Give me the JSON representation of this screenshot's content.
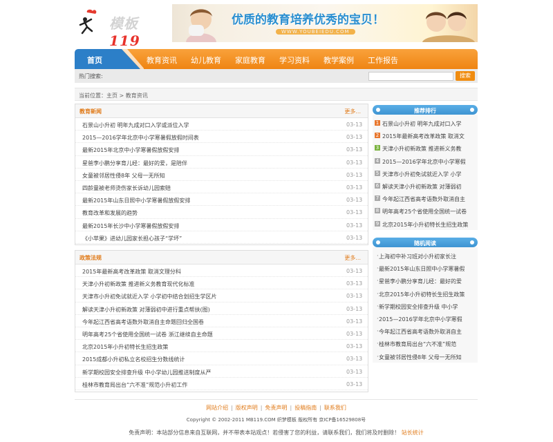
{
  "logo": {
    "text_a": "模板",
    "text_b": "119"
  },
  "banner": {
    "slogan": "优质的教育培养优秀的宝贝！",
    "url": "WWW.YOUBEIEDU.COM"
  },
  "nav": {
    "items": [
      "首页",
      "教育资讯",
      "幼儿教育",
      "家庭教育",
      "学习资料",
      "教学案例",
      "工作报告"
    ]
  },
  "search": {
    "hot_label": "热门搜索:",
    "button": "搜索",
    "placeholder": ""
  },
  "breadcrumb": "当前位置：主页 > 教育资讯",
  "education_news": {
    "title": "教育新闻",
    "more": "更多...",
    "items": [
      {
        "title": "石景山小升初 明年九成对口入学或派位入学",
        "date": "03-13"
      },
      {
        "title": "2015—2016学年北京中小学寒暑假放假时间表",
        "date": "03-13"
      },
      {
        "title": "最新2015年北京中小学寒暑假放假安排",
        "date": "03-13"
      },
      {
        "title": "星爸李小鹏分享育儿经：最好的爱，是陪伴",
        "date": "03-13"
      },
      {
        "title": "女童被邻居性侵8年 父母一无所知",
        "date": "03-13"
      },
      {
        "title": "四龄童被老师烫伤家长诉幼儿园索赔",
        "date": "03-13"
      },
      {
        "title": "最新2015年山东日照中小学寒暑假放假安排",
        "date": "03-13"
      },
      {
        "title": "教育改革和发展的趋势",
        "date": "03-13"
      },
      {
        "title": "最新2015年长沙中小学寒暑假放假安排",
        "date": "03-13"
      },
      {
        "title": "《小苹果》进幼儿园家长担心孩子“学坏”",
        "date": "03-13"
      }
    ]
  },
  "policy": {
    "title": "政策法规",
    "more": "更多...",
    "items": [
      {
        "title": "2015年最新高考改革政策 取消文理分科",
        "date": "03-13"
      },
      {
        "title": "天津小升初新政策 推进新义务教育现代化标准",
        "date": "03-13"
      },
      {
        "title": "天津市小升初免试就近入学 小学初中结合划招生学区片",
        "date": "03-13"
      },
      {
        "title": "解读天津小升初新政策 对薄弱初中进行重点帮扶(图)",
        "date": "03-13"
      },
      {
        "title": "今年起江西省高考语数外取消自主命题回归全国卷",
        "date": "03-13"
      },
      {
        "title": "明年高考25个省使用全国统一试卷 浙江继续自主命题",
        "date": "03-13"
      },
      {
        "title": "北京2015年小升初特长生招生政策",
        "date": "03-13"
      },
      {
        "title": "2015成都小升初私立名校招生分数线统计",
        "date": "03-13"
      },
      {
        "title": "新学期校园安全排查升级 中小学幼儿园推送制度从严",
        "date": "03-13"
      },
      {
        "title": "桂林市教育局出台“六不准”规范小升初工作",
        "date": "03-13"
      }
    ]
  },
  "recommend": {
    "title": "推荐排行",
    "items": [
      "石景山小升初 明年九成对口入学",
      "2015年最新高考改革政策 取消文",
      "天津小升初新政策 推进新义务教",
      "2015—2016学年北京中小学寒假",
      "天津市小升初免试就近入学 小学",
      "解读天津小升初新政策 对薄弱初",
      "今年起江西省高考语数外取消自主",
      "明年高考25个省使用全国统一试卷",
      "北京2015年小升初特长生招生政策"
    ]
  },
  "random": {
    "title": "随机阅读",
    "items": [
      "上海初中补习班对小升初家长注",
      "最新2015年山东日照中小学寒暑假",
      "星爸李小鹏分享育儿经：最好的爱",
      "北京2015年小升初特长生招生政策",
      "新学期校园安全排查升级 中小学",
      "2015—2016学年北京中小学寒假",
      "今年起江西省高考语数外取消自主",
      "桂林市教育局出台“六不准”规范",
      "女童被邻居性侵8年 父母一无所知"
    ]
  },
  "footer": {
    "links": [
      "网站介绍",
      "版权声明",
      "免责声明",
      "投稿指南",
      "联系我们"
    ],
    "copyright": "Copyright © 2002-2011 MB119.COM 织梦模板 版权所有 京ICP备16529808号",
    "disclaimer": "免责声明：本站部分信息来自互联网，并不带表本站观点！若侵害了您的利益，请联系我们，我们将及时删除！",
    "stats": "站长统计"
  },
  "colors": {
    "orange": "#f08c10",
    "blue": "#3e94d2",
    "link_orange": "#e07b1a"
  }
}
